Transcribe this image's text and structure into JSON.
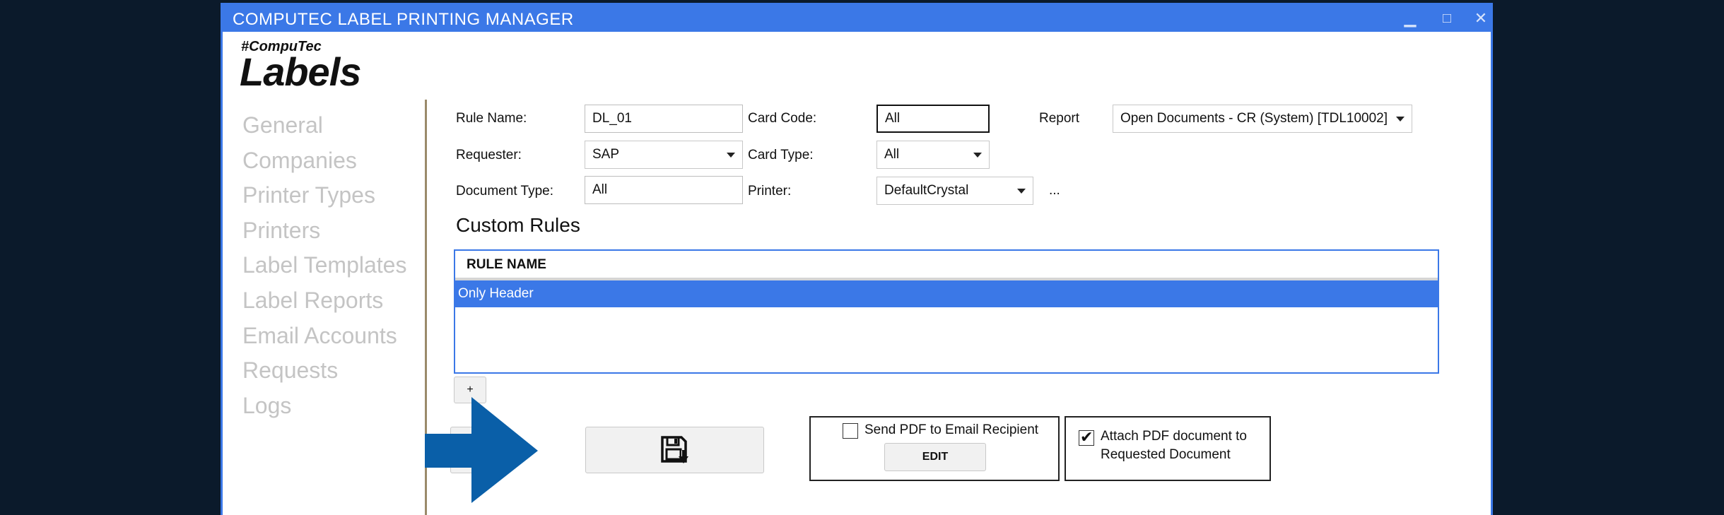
{
  "window": {
    "title": "COMPUTEC LABEL PRINTING MANAGER",
    "minimize": "▁",
    "maximize": "□",
    "close": "✕"
  },
  "brand": {
    "tag": "#CompuTec",
    "name": "Labels"
  },
  "nav": {
    "items": [
      "General",
      "Companies",
      "Printer Types",
      "Printers",
      "Label Templates",
      "Label Reports",
      "Email Accounts",
      "Requests",
      "Logs"
    ]
  },
  "form": {
    "rule_name_label": "Rule Name:",
    "rule_name_value": "DL_01",
    "card_code_label": "Card Code:",
    "card_code_value": "All",
    "report_label": "Report",
    "report_value": "Open Documents - CR (System)  [TDL10002]",
    "requester_label": "Requester:",
    "requester_value": "SAP",
    "card_type_label": "Card Type:",
    "card_type_value": "All",
    "document_type_label": "Document Type:",
    "document_type_value": "All",
    "printer_label": "Printer:",
    "printer_value": "DefaultCrystal",
    "more_label": "..."
  },
  "custom_rules": {
    "title": "Custom Rules",
    "column_header": "RULE NAME",
    "rows": [
      "Only Header"
    ],
    "add_label": "+"
  },
  "actions": {
    "save_icon": "save-download-icon",
    "send_pdf_label": "Send PDF to Email Recipient",
    "send_pdf_checked": false,
    "edit_label": "EDIT",
    "attach_pdf_label_line1": "Attach PDF document to",
    "attach_pdf_label_line2": "Requested Document",
    "attach_pdf_checked": true
  },
  "colors": {
    "accent": "#3b78e7",
    "background": "#0b1a2b",
    "arrow": "#0a5fa8",
    "nav_text": "#c4c4c4"
  }
}
